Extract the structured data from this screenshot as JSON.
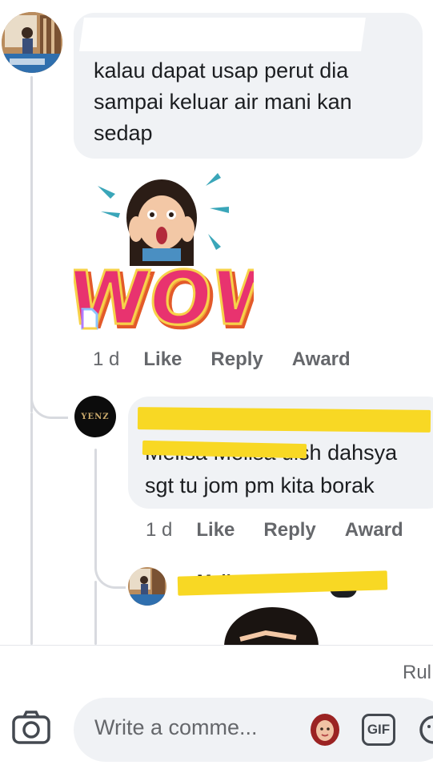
{
  "comment1": {
    "text_line1": "kalau dapat usap perut dia",
    "text_line2": "sampai keluar air mani kan",
    "text_line3": "sedap",
    "sticker_text": "WOW",
    "time": "1 d",
    "like": "Like",
    "reply": "Reply",
    "award": "Award"
  },
  "reply1": {
    "avatar_label": "YENZ",
    "text_line1": "Melisa Melisa uish dahsya",
    "text_line2": "sgt tu jom pm kita borak",
    "time": "1 d",
    "like": "Like",
    "reply": "Reply",
    "award": "Award"
  },
  "reply2": {
    "author_fragment": "Melisa Melisa"
  },
  "composer": {
    "rules_text": "Rul",
    "placeholder": "Write a comme...",
    "gif_label": "GIF"
  },
  "colors": {
    "bubble": "#f0f2f5",
    "highlight": "#f8d824",
    "muted_text": "#65676b"
  }
}
